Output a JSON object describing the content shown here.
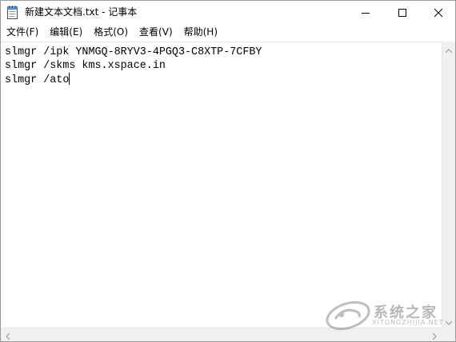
{
  "window": {
    "title": "新建文本文档.txt - 记事本"
  },
  "window_controls": {
    "minimize_icon": "minimize-icon",
    "maximize_icon": "maximize-icon",
    "close_icon": "close-icon"
  },
  "menu": {
    "items": [
      {
        "label": "文件(F)"
      },
      {
        "label": "编辑(E)"
      },
      {
        "label": "格式(O)"
      },
      {
        "label": "查看(V)"
      },
      {
        "label": "帮助(H)"
      }
    ]
  },
  "editor": {
    "lines": [
      "slmgr /ipk YNMGQ-8RYV3-4PGQ3-C8XTP-7CFBY",
      "slmgr /skms kms.xspace.in",
      "slmgr /ato"
    ]
  },
  "watermark": {
    "brand": "系统之家",
    "sub": "XITONGZHIJIA.NET",
    "icon": "watermark-logo-icon"
  },
  "colors": {
    "window_bg": "#ffffff",
    "border": "#9a9a9a",
    "scrollbar_bg": "#f0f0f0",
    "text": "#000000"
  }
}
